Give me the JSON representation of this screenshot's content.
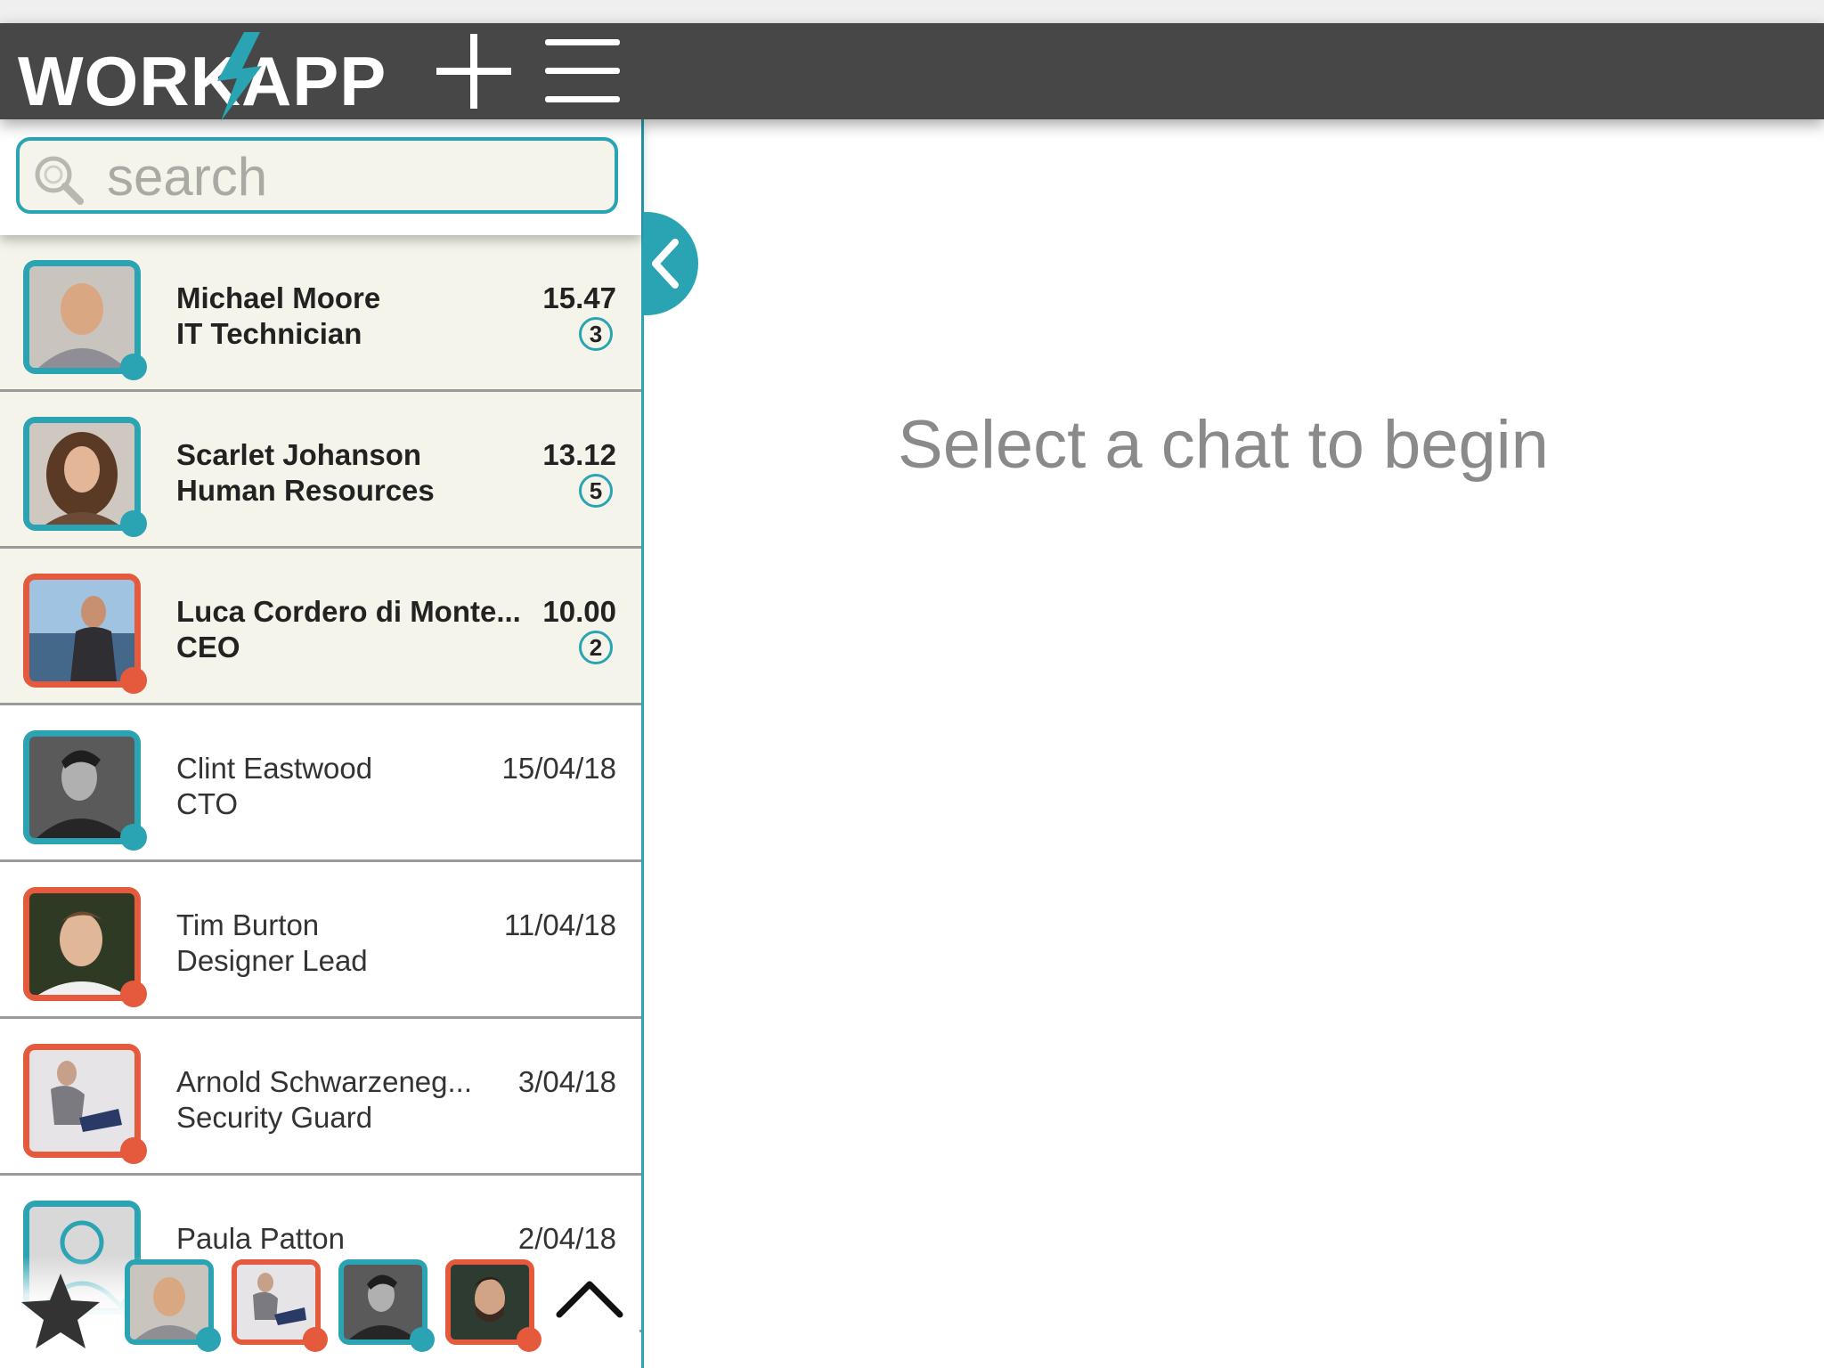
{
  "app": {
    "logo_text": "WORKAPP",
    "add_label": "+",
    "menu_label": "menu"
  },
  "search": {
    "placeholder": "search"
  },
  "chats": [
    {
      "name": "Michael Moore",
      "role": "IT Technician",
      "time": "15.47",
      "unread": "3",
      "status": "online"
    },
    {
      "name": "Scarlet Johanson",
      "role": "Human Resources",
      "time": "13.12",
      "unread": "5",
      "status": "online"
    },
    {
      "name": "Luca Cordero di Monte...",
      "role": "CEO",
      "time": "10.00",
      "unread": "2",
      "status": "offline"
    },
    {
      "name": "Clint Eastwood",
      "role": "CTO",
      "time": "15/04/18",
      "unread": "",
      "status": "online"
    },
    {
      "name": "Tim Burton",
      "role": "Designer Lead",
      "time": "11/04/18",
      "unread": "",
      "status": "offline"
    },
    {
      "name": "Arnold Schwarzeneg...",
      "role": "Security Guard",
      "time": "3/04/18",
      "unread": "",
      "status": "offline"
    },
    {
      "name": "Paula Patton",
      "role": "",
      "time": "2/04/18",
      "unread": "",
      "status": "online"
    }
  ],
  "main": {
    "empty_message": "Select a chat to begin"
  },
  "favorites": [
    {
      "status": "online"
    },
    {
      "status": "offline"
    },
    {
      "status": "online"
    },
    {
      "status": "offline"
    }
  ],
  "colors": {
    "accent": "#2aa3b3",
    "offline": "#e55a3c",
    "header": "#474747",
    "unread_bg": "#f4f4ea"
  }
}
